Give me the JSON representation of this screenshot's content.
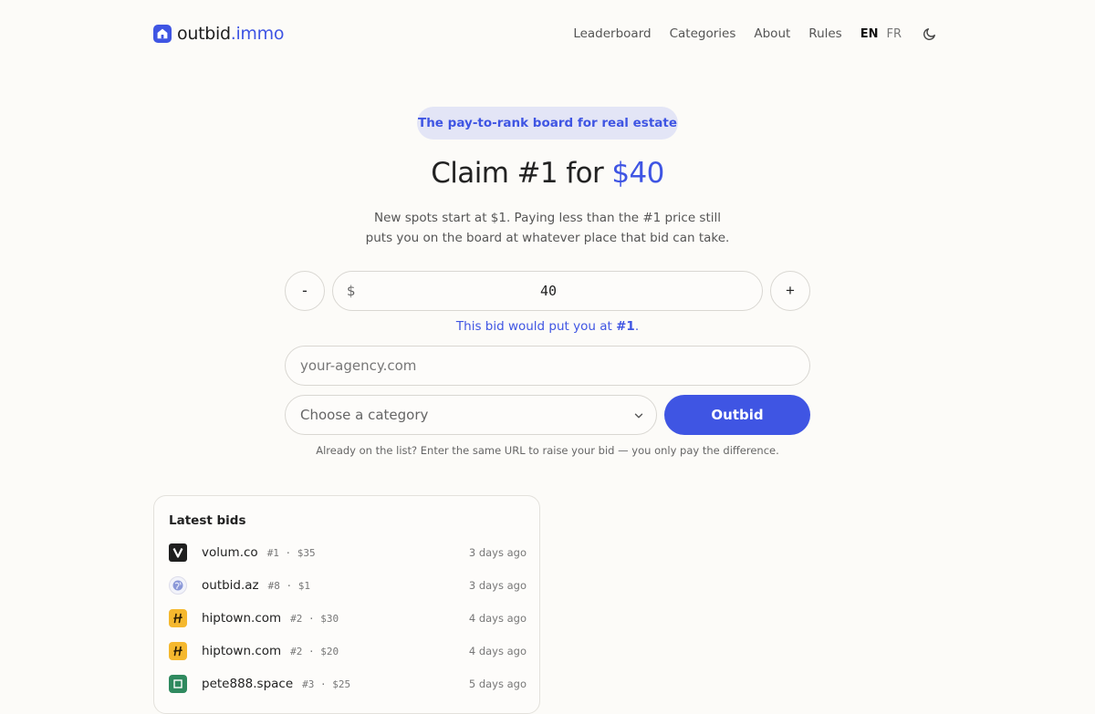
{
  "brand": {
    "name": "outbid",
    "tld": ".immo"
  },
  "nav": {
    "leaderboard": "Leaderboard",
    "categories": "Categories",
    "about": "About",
    "rules": "Rules",
    "lang_en": "EN",
    "lang_fr": "FR"
  },
  "hero": {
    "pill": "The pay-to-rank board for real estate",
    "headline_prefix": "Claim #1 for ",
    "headline_price": "$40",
    "sub_line1": "New spots start at $1. Paying less than the #1 price still",
    "sub_line2": "puts you on the board at whatever place that bid can take."
  },
  "bid_form": {
    "minus": "-",
    "plus": "+",
    "currency": "$",
    "amount": "40",
    "note_prefix": "This bid would put you at ",
    "note_rank": "#1",
    "note_suffix": ".",
    "url_placeholder": "your-agency.com",
    "category_selected": "Choose a category",
    "submit_label": "Outbid",
    "hint": "Already on the list? Enter the same URL to raise your bid — you only pay the difference."
  },
  "latest_bids": {
    "title": "Latest bids",
    "items": [
      {
        "domain": "volum.co",
        "meta": "#1 · $35",
        "time": "3 days ago",
        "icon": "volum-icon"
      },
      {
        "domain": "outbid.az",
        "meta": "#8 · $1",
        "time": "3 days ago",
        "icon": "globe-icon"
      },
      {
        "domain": "hiptown.com",
        "meta": "#2 · $30",
        "time": "4 days ago",
        "icon": "hiptown-icon"
      },
      {
        "domain": "hiptown.com",
        "meta": "#2 · $20",
        "time": "4 days ago",
        "icon": "hiptown-icon"
      },
      {
        "domain": "pete888.space",
        "meta": "#3 · $25",
        "time": "5 days ago",
        "icon": "pete-icon"
      }
    ]
  },
  "colors": {
    "accent": "#3f55e3",
    "background": "#fcfbf8",
    "pill_bg": "#e3e5f6",
    "hiptown_yellow": "#f5b82e"
  }
}
